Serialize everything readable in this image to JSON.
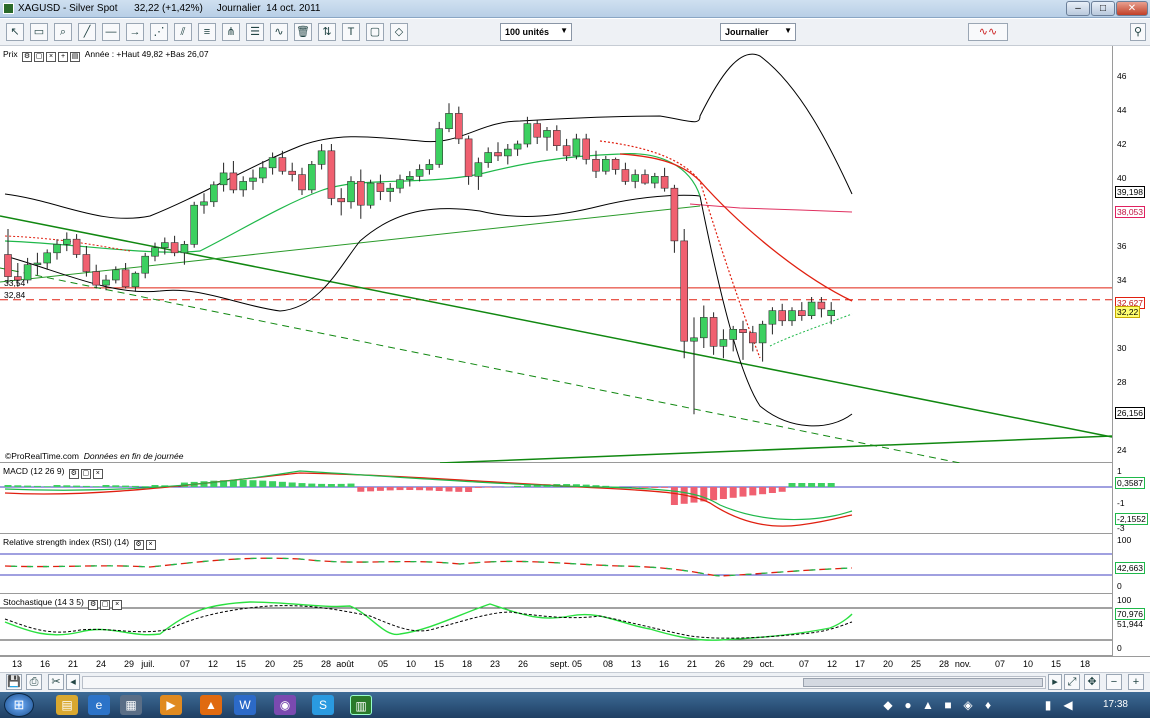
{
  "window": {
    "title": "XAGUSD - Silver Spot      32,22 (+1,42%)     Journalier  14 oct. 2011"
  },
  "toolbar": {
    "units_select": "100 unités",
    "period_select": "Journalier",
    "icons": [
      "cursor-icon",
      "ruler-icon",
      "zoom-icon",
      "trend-line-icon",
      "horizontal-line-icon",
      "fan-icon",
      "fibonacci-icon",
      "channel-icon",
      "delete-icon",
      "pitchfork-icon",
      "text-icon",
      "rectangle-icon",
      "ellipse-icon",
      "shapes-icon"
    ]
  },
  "price_pane": {
    "label": "Prix",
    "legend": "Année : +Haut 49,82 +Bas 26,07",
    "footnote_site": "ProRealTime.com",
    "footnote_note": "Données en fin de journée",
    "left_levels": [
      "33,54",
      "32,84"
    ],
    "axis_ticks": [
      "46",
      "44",
      "42",
      "40",
      "38",
      "36",
      "34",
      "32",
      "30",
      "28",
      "26",
      "24"
    ],
    "boxes": {
      "upper_bb": "39,198",
      "ma200": "38,053",
      "red_level": "32,627",
      "last": "32,22",
      "lower_bb": "26,156"
    }
  },
  "macd_pane": {
    "label": "MACD (12 26 9)",
    "ticks": [
      "1",
      "-1",
      "-3"
    ],
    "boxes": {
      "hist": "0,3587",
      "line": "-2,1552"
    }
  },
  "rsi_pane": {
    "label": "Relative strength index (RSI) (14)",
    "ticks": [
      "100",
      "0"
    ],
    "boxes": {
      "rsi": "42,663"
    }
  },
  "stoch_pane": {
    "label": "Stochastique (14 3 5)",
    "ticks": [
      "100",
      "0"
    ],
    "boxes": {
      "k": "70,976",
      "d": "51,944"
    }
  },
  "x_axis": {
    "labels": [
      {
        "t": "13",
        "x": 17
      },
      {
        "t": "16",
        "x": 45
      },
      {
        "t": "21",
        "x": 73
      },
      {
        "t": "24",
        "x": 101
      },
      {
        "t": "29",
        "x": 129
      },
      {
        "t": "juil.",
        "x": 148
      },
      {
        "t": "07",
        "x": 185
      },
      {
        "t": "12",
        "x": 213
      },
      {
        "t": "15",
        "x": 241
      },
      {
        "t": "20",
        "x": 270
      },
      {
        "t": "25",
        "x": 298
      },
      {
        "t": "28",
        "x": 326
      },
      {
        "t": "août",
        "x": 345
      },
      {
        "t": "05",
        "x": 383
      },
      {
        "t": "10",
        "x": 411
      },
      {
        "t": "15",
        "x": 439
      },
      {
        "t": "18",
        "x": 467
      },
      {
        "t": "23",
        "x": 495
      },
      {
        "t": "26",
        "x": 523
      },
      {
        "t": "sept. 05",
        "x": 566
      },
      {
        "t": "08",
        "x": 608
      },
      {
        "t": "13",
        "x": 636
      },
      {
        "t": "16",
        "x": 664
      },
      {
        "t": "21",
        "x": 692
      },
      {
        "t": "26",
        "x": 720
      },
      {
        "t": "29",
        "x": 748
      },
      {
        "t": "oct.",
        "x": 767
      },
      {
        "t": "07",
        "x": 804
      },
      {
        "t": "12",
        "x": 832
      },
      {
        "t": "17",
        "x": 860
      },
      {
        "t": "20",
        "x": 888
      },
      {
        "t": "25",
        "x": 916
      },
      {
        "t": "28",
        "x": 944
      },
      {
        "t": "nov.",
        "x": 963
      },
      {
        "t": "07",
        "x": 1000
      },
      {
        "t": "10",
        "x": 1028
      },
      {
        "t": "15",
        "x": 1056
      },
      {
        "t": "18",
        "x": 1085
      }
    ]
  },
  "taskbar": {
    "clock": "17:38"
  },
  "chart_data": {
    "type": "candlestick",
    "instrument": "XAGUSD",
    "ylim": [
      23,
      48
    ],
    "candles": [
      [
        35.5,
        37.0,
        33.8,
        34.2
      ],
      [
        34.2,
        35.0,
        33.6,
        34.0
      ],
      [
        34.0,
        35.3,
        33.8,
        34.9
      ],
      [
        34.9,
        35.6,
        34.3,
        35.0
      ],
      [
        35.0,
        35.8,
        34.6,
        35.6
      ],
      [
        35.6,
        36.4,
        35.2,
        36.1
      ],
      [
        36.1,
        36.8,
        35.7,
        36.4
      ],
      [
        36.4,
        36.7,
        35.3,
        35.5
      ],
      [
        35.5,
        36.0,
        34.2,
        34.5
      ],
      [
        34.5,
        34.9,
        33.5,
        33.7
      ],
      [
        33.7,
        34.3,
        33.4,
        34.0
      ],
      [
        34.0,
        34.8,
        33.8,
        34.6
      ],
      [
        34.6,
        35.0,
        33.5,
        33.6
      ],
      [
        33.6,
        34.5,
        33.3,
        34.4
      ],
      [
        34.4,
        35.6,
        34.1,
        35.4
      ],
      [
        35.4,
        36.2,
        35.1,
        35.9
      ],
      [
        35.9,
        36.5,
        35.5,
        36.2
      ],
      [
        36.2,
        36.6,
        35.4,
        35.6
      ],
      [
        35.6,
        36.3,
        34.9,
        36.1
      ],
      [
        36.1,
        38.6,
        35.9,
        38.4
      ],
      [
        38.4,
        39.1,
        37.9,
        38.6
      ],
      [
        38.6,
        39.8,
        38.3,
        39.6
      ],
      [
        39.6,
        40.9,
        39.2,
        40.3
      ],
      [
        40.3,
        41.0,
        39.1,
        39.3
      ],
      [
        39.3,
        40.1,
        38.9,
        39.8
      ],
      [
        39.8,
        40.5,
        39.3,
        40.0
      ],
      [
        40.0,
        41.0,
        39.7,
        40.6
      ],
      [
        40.6,
        41.5,
        40.2,
        41.2
      ],
      [
        41.2,
        41.6,
        40.2,
        40.4
      ],
      [
        40.4,
        40.9,
        39.8,
        40.2
      ],
      [
        40.2,
        40.6,
        39.0,
        39.3
      ],
      [
        39.3,
        41.0,
        39.1,
        40.8
      ],
      [
        40.8,
        42.0,
        40.5,
        41.6
      ],
      [
        41.6,
        42.0,
        38.4,
        38.8
      ],
      [
        38.8,
        39.4,
        37.8,
        38.6
      ],
      [
        38.6,
        40.1,
        38.2,
        39.8
      ],
      [
        39.8,
        40.5,
        37.6,
        38.4
      ],
      [
        38.4,
        39.9,
        38.2,
        39.7
      ],
      [
        39.7,
        40.2,
        38.7,
        39.2
      ],
      [
        39.2,
        39.7,
        38.6,
        39.4
      ],
      [
        39.4,
        40.2,
        39.1,
        39.9
      ],
      [
        39.9,
        40.4,
        39.5,
        40.1
      ],
      [
        40.1,
        40.8,
        39.8,
        40.5
      ],
      [
        40.5,
        41.1,
        40.2,
        40.8
      ],
      [
        40.8,
        43.3,
        40.6,
        42.9
      ],
      [
        42.9,
        44.4,
        42.7,
        43.8
      ],
      [
        43.8,
        44.2,
        42.0,
        42.3
      ],
      [
        42.3,
        42.5,
        39.6,
        40.1
      ],
      [
        40.1,
        41.2,
        39.3,
        40.9
      ],
      [
        40.9,
        41.8,
        40.6,
        41.5
      ],
      [
        41.5,
        42.1,
        41.0,
        41.3
      ],
      [
        41.3,
        42.0,
        40.8,
        41.7
      ],
      [
        41.7,
        42.2,
        41.3,
        42.0
      ],
      [
        42.0,
        43.6,
        41.8,
        43.2
      ],
      [
        43.2,
        43.4,
        42.0,
        42.4
      ],
      [
        42.4,
        43.0,
        41.6,
        42.8
      ],
      [
        42.8,
        43.1,
        41.6,
        41.9
      ],
      [
        41.9,
        42.3,
        41.0,
        41.3
      ],
      [
        41.3,
        42.6,
        41.1,
        42.3
      ],
      [
        42.3,
        42.6,
        40.8,
        41.1
      ],
      [
        41.1,
        41.6,
        40.0,
        40.4
      ],
      [
        40.4,
        41.3,
        40.2,
        41.1
      ],
      [
        41.1,
        41.2,
        40.2,
        40.5
      ],
      [
        40.5,
        40.9,
        39.6,
        39.8
      ],
      [
        39.8,
        40.5,
        39.4,
        40.2
      ],
      [
        40.2,
        40.5,
        39.6,
        39.7
      ],
      [
        39.7,
        40.3,
        39.4,
        40.1
      ],
      [
        40.1,
        40.6,
        39.2,
        39.4
      ],
      [
        39.4,
        39.6,
        35.6,
        36.3
      ],
      [
        36.3,
        37.0,
        29.4,
        30.4
      ],
      [
        30.4,
        31.8,
        26.1,
        30.6
      ],
      [
        30.6,
        32.5,
        30.0,
        31.8
      ],
      [
        31.8,
        32.1,
        29.6,
        30.1
      ],
      [
        30.1,
        31.1,
        29.4,
        30.5
      ],
      [
        30.5,
        31.3,
        29.8,
        31.1
      ],
      [
        31.1,
        31.6,
        29.3,
        30.9
      ],
      [
        30.9,
        31.3,
        29.8,
        30.3
      ],
      [
        30.3,
        31.6,
        29.2,
        31.4
      ],
      [
        31.4,
        32.4,
        30.8,
        32.2
      ],
      [
        32.2,
        32.6,
        31.3,
        31.6
      ],
      [
        31.6,
        32.4,
        31.3,
        32.2
      ],
      [
        32.2,
        32.7,
        31.6,
        31.9
      ],
      [
        31.9,
        33.0,
        31.7,
        32.7
      ],
      [
        32.7,
        33.0,
        31.8,
        32.3
      ],
      [
        31.9,
        32.7,
        31.4,
        32.22
      ]
    ],
    "lines": {
      "upper_bb_color": "#000000",
      "ma_fast_color": "#1fb84a",
      "ma_red_color": "#e02010",
      "ma200_color": "#2a9a2a",
      "trend_color": "#118811"
    },
    "levels": {
      "resistance_red": 33.54,
      "dashed_red": 32.84
    }
  }
}
